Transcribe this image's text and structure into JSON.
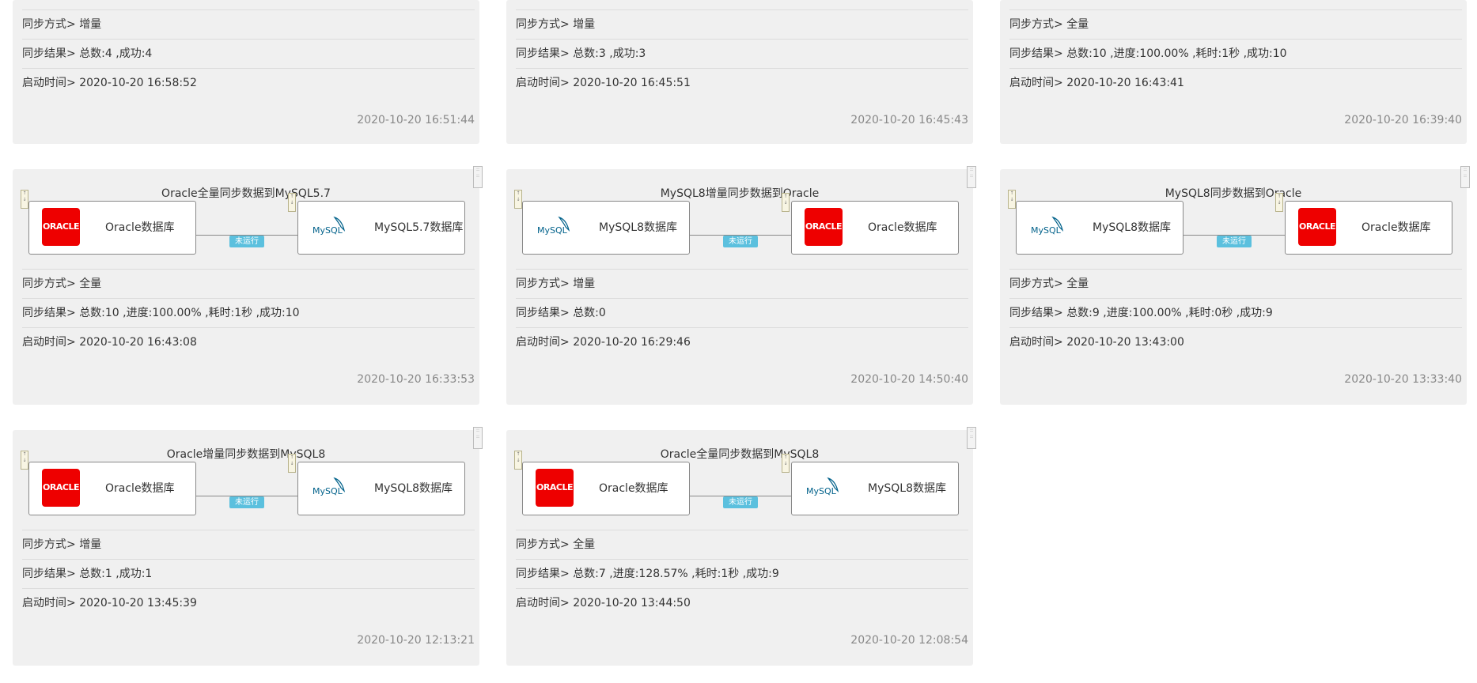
{
  "labels": {
    "mode_prefix": "同步方式> ",
    "result_prefix": "同步结果> ",
    "start_prefix": "启动时间> "
  },
  "cards": [
    {
      "mode": "增量",
      "result": "总数:4 ,成功:4",
      "start": "2020-10-20 16:58:52",
      "timestamp": "2020-10-20 16:51:44"
    },
    {
      "mode": "增量",
      "result": "总数:3 ,成功:3",
      "start": "2020-10-20 16:45:51",
      "timestamp": "2020-10-20 16:45:43"
    },
    {
      "mode": "全量",
      "result": "总数:10 ,进度:100.00% ,耗时:1秒 ,成功:10",
      "start": "2020-10-20 16:43:41",
      "timestamp": "2020-10-20 16:39:40"
    },
    {
      "title": "Oracle全量同步数据到MySQL5.7",
      "source": {
        "type": "oracle",
        "name": "Oracle数据库"
      },
      "target": {
        "type": "mysql",
        "name": "MySQL5.7数据库"
      },
      "status": "未运行",
      "mode": "全量",
      "result": "总数:10 ,进度:100.00% ,耗时:1秒 ,成功:10",
      "start": "2020-10-20 16:43:08",
      "timestamp": "2020-10-20 16:33:53"
    },
    {
      "title": "MySQL8增量同步数据到Oracle",
      "source": {
        "type": "mysql",
        "name": "MySQL8数据库"
      },
      "target": {
        "type": "oracle",
        "name": "Oracle数据库"
      },
      "status": "未运行",
      "mode": "增量",
      "result": "总数:0",
      "start": "2020-10-20 16:29:46",
      "timestamp": "2020-10-20 14:50:40"
    },
    {
      "title": "MySQL8同步数据到Oracle",
      "source": {
        "type": "mysql",
        "name": "MySQL8数据库"
      },
      "target": {
        "type": "oracle",
        "name": "Oracle数据库"
      },
      "status": "未运行",
      "mode": "全量",
      "result": "总数:9 ,进度:100.00% ,耗时:0秒 ,成功:9",
      "start": "2020-10-20 13:43:00",
      "timestamp": "2020-10-20 13:33:40"
    },
    {
      "title": "Oracle增量同步数据到MySQL8",
      "source": {
        "type": "oracle",
        "name": "Oracle数据库"
      },
      "target": {
        "type": "mysql",
        "name": "MySQL8数据库"
      },
      "status": "未运行",
      "mode": "增量",
      "result": "总数:1 ,成功:1",
      "start": "2020-10-20 13:45:39",
      "timestamp": "2020-10-20 12:13:21"
    },
    {
      "title": "Oracle全量同步数据到MySQL8",
      "source": {
        "type": "oracle",
        "name": "Oracle数据库"
      },
      "target": {
        "type": "mysql",
        "name": "MySQL8数据库"
      },
      "status": "未运行",
      "mode": "全量",
      "result": "总数:7 ,进度:128.57% ,耗时:1秒 ,成功:9",
      "start": "2020-10-20 13:44:50",
      "timestamp": "2020-10-20 12:08:54"
    }
  ],
  "colors": {
    "card_bg": "#f0f0f0",
    "status_badge": "#5bc0de",
    "oracle_red": "#ee0000"
  },
  "logo_texts": {
    "oracle": "ORACLE",
    "mysql": "MySQL"
  }
}
